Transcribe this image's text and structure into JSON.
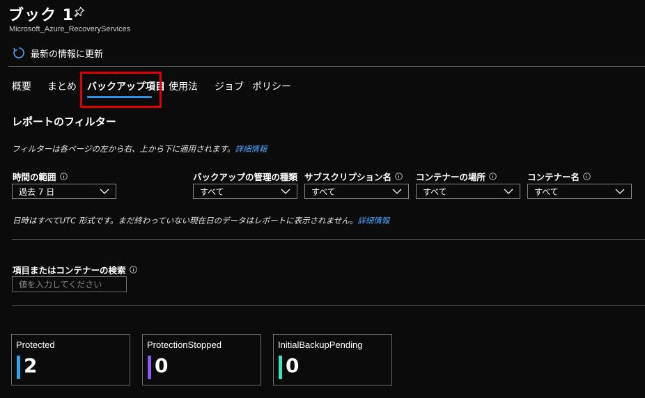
{
  "header": {
    "title": "ブック 1",
    "subtitle": "Microsoft_Azure_RecoveryServices",
    "refresh_label": "最新の情報に更新"
  },
  "tabs": [
    {
      "label": "概要",
      "active": false
    },
    {
      "label": "まとめ",
      "active": false
    },
    {
      "label": "バックアップ項目",
      "active": true
    },
    {
      "label": "使用法",
      "active": false
    },
    {
      "label": "ジョブ",
      "active": false
    },
    {
      "label": "ポリシー",
      "active": false
    }
  ],
  "filters_section": {
    "title": "レポートのフィルター",
    "note": "フィルターは各ページの左から右、上から下に適用されます。",
    "note_link": "詳細情報",
    "filters": [
      {
        "label": "時間の範囲",
        "value": "過去 7 日",
        "has_info": true
      },
      {
        "label": "バックアップの管理の種類",
        "value": "すべて",
        "has_info": false
      },
      {
        "label": "サブスクリプション名",
        "value": "すべて",
        "has_info": true
      },
      {
        "label": "コンテナーの場所",
        "value": "すべて",
        "has_info": true
      },
      {
        "label": "コンテナー名",
        "value": "すべて",
        "has_info": true
      }
    ],
    "utc_note": "日時はすべてUTC 形式です。まだ終わっていない現在日のデータはレポートに表示されません。",
    "utc_link": "詳細情報"
  },
  "search": {
    "label": "項目またはコンテナーの検索",
    "placeholder": "値を入力してください",
    "value": ""
  },
  "cards": [
    {
      "label": "Protected",
      "value": "2",
      "color": "#2fa3e6"
    },
    {
      "label": "ProtectionStopped",
      "value": "0",
      "color": "#8a5cf6"
    },
    {
      "label": "InitialBackupPending",
      "value": "0",
      "color": "#3fe0c0"
    }
  ],
  "colors": {
    "background": "#0b0b0b",
    "accent": "#2f8fe0",
    "link": "#4aa3ff",
    "highlight": "#e00000"
  }
}
